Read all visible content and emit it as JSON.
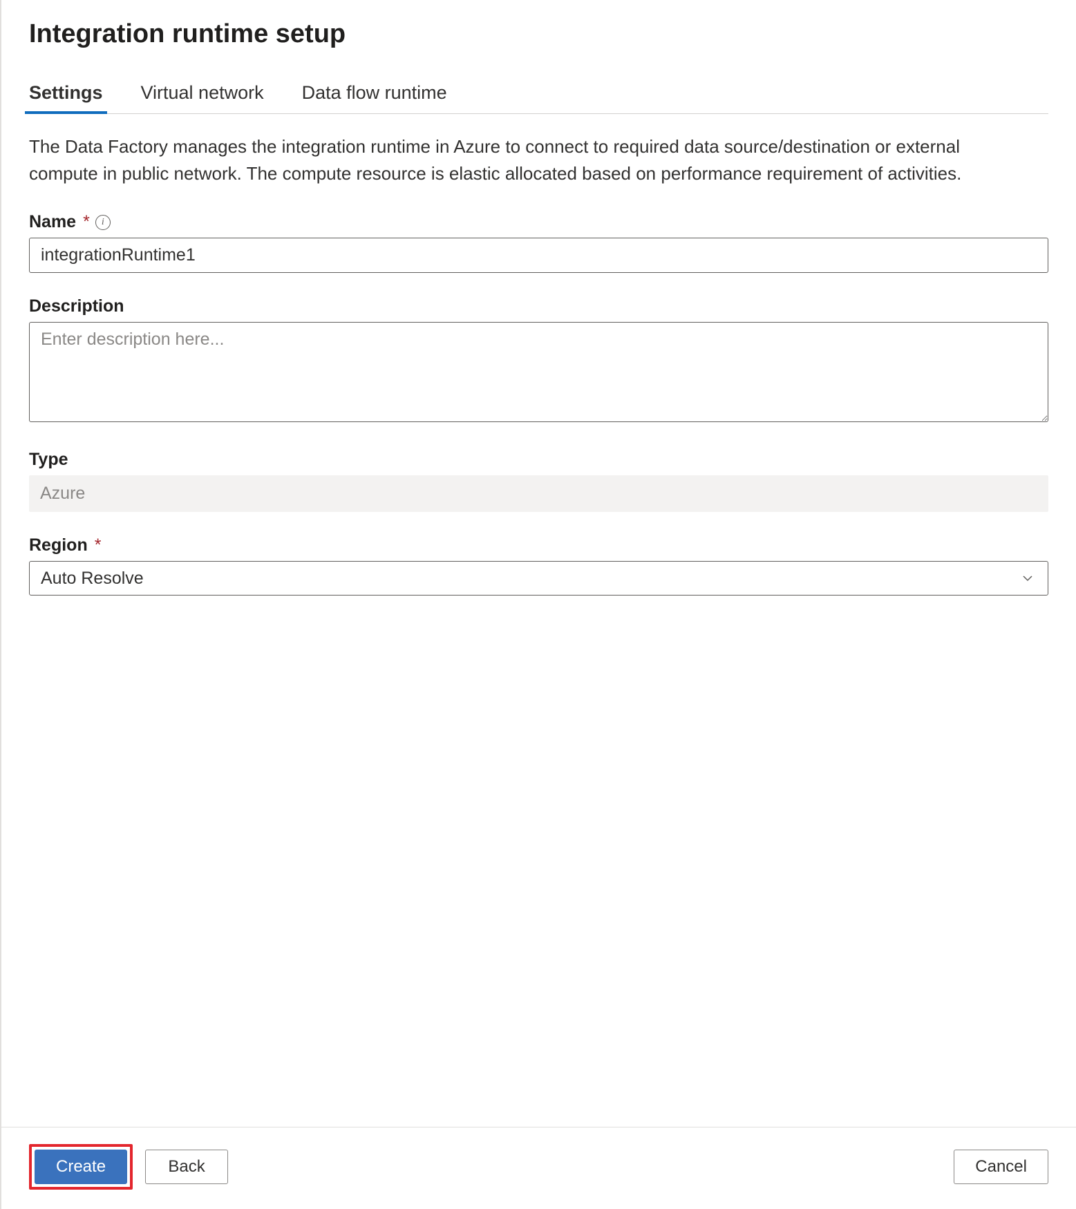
{
  "title": "Integration runtime setup",
  "tabs": [
    {
      "label": "Settings",
      "active": true
    },
    {
      "label": "Virtual network",
      "active": false
    },
    {
      "label": "Data flow runtime",
      "active": false
    }
  ],
  "description_text": "The Data Factory manages the integration runtime in Azure to connect to required data source/destination or external compute in public network. The compute resource is elastic allocated based on performance requirement of activities.",
  "fields": {
    "name": {
      "label": "Name",
      "required": true,
      "has_info": true,
      "value": "integrationRuntime1"
    },
    "description": {
      "label": "Description",
      "required": false,
      "placeholder": "Enter description here...",
      "value": ""
    },
    "type": {
      "label": "Type",
      "required": false,
      "value": "Azure"
    },
    "region": {
      "label": "Region",
      "required": true,
      "value": "Auto Resolve"
    }
  },
  "footer": {
    "create": "Create",
    "back": "Back",
    "cancel": "Cancel"
  }
}
